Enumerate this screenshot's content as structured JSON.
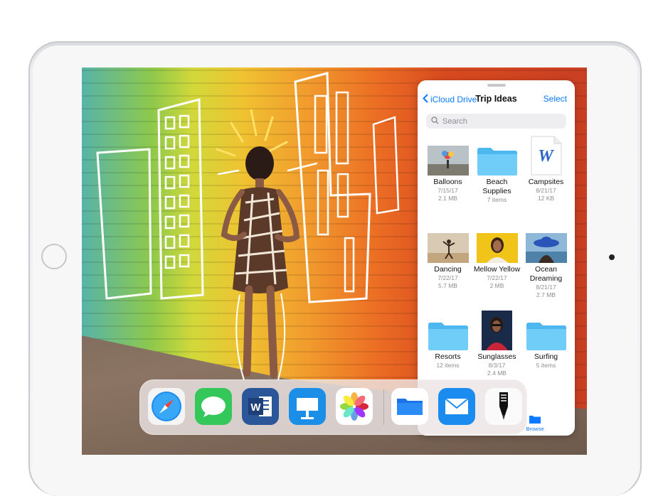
{
  "files_panel": {
    "back_label": "iCloud Drive",
    "title": "Trip Ideas",
    "select_label": "Select",
    "search_placeholder": "Search",
    "items": [
      {
        "name": "Balloons",
        "date": "7/15/17",
        "info": "2.1 MB",
        "kind": "photo"
      },
      {
        "name": "Beach Supplies",
        "date": "",
        "info": "7 items",
        "kind": "folder"
      },
      {
        "name": "Campsites",
        "date": "8/21/17",
        "info": "12 KB",
        "kind": "word-doc"
      },
      {
        "name": "Dancing",
        "date": "7/22/17",
        "info": "5.7 MB",
        "kind": "photo"
      },
      {
        "name": "Mellow Yellow",
        "date": "7/22/17",
        "info": "2 MB",
        "kind": "photo"
      },
      {
        "name": "Ocean Dreaming",
        "date": "8/21/17",
        "info": "2.7 MB",
        "kind": "photo"
      },
      {
        "name": "Resorts",
        "date": "",
        "info": "12 items",
        "kind": "folder"
      },
      {
        "name": "Sunglasses",
        "date": "8/3/17",
        "info": "2.4 MB",
        "kind": "photo"
      },
      {
        "name": "Surfing",
        "date": "",
        "info": "5 items",
        "kind": "folder"
      }
    ],
    "tab_label": "Browse"
  },
  "dock": {
    "apps": [
      "Safari",
      "Messages",
      "Word",
      "Keynote",
      "Photos",
      "Files",
      "Mail",
      "Markup"
    ]
  },
  "colors": {
    "accent": "#0a7aff",
    "folder": "#5ac8fa",
    "secondary_text": "#8e8e93"
  }
}
